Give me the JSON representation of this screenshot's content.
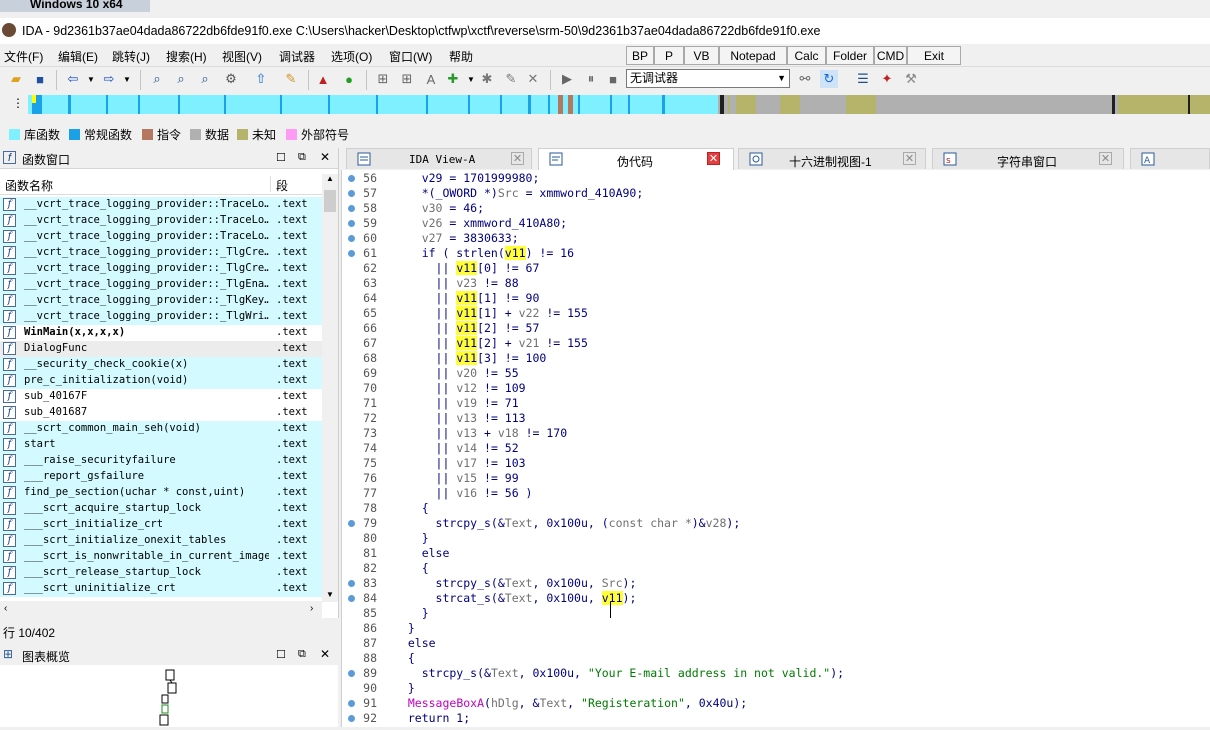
{
  "vm_tab": "Windows 10 x64",
  "window_title": "IDA - 9d2361b37ae04dada86722db6fde91f0.exe C:\\Users\\hacker\\Desktop\\ctfwp\\xctf\\reverse\\srm-50\\9d2361b37ae04dada86722db6fde91f0.exe",
  "menu": [
    "文件(F)",
    "编辑(E)",
    "跳转(J)",
    "搜索(H)",
    "视图(V)",
    "调试器",
    "选项(O)",
    "窗口(W)",
    "帮助"
  ],
  "plugin_buttons": [
    "BP",
    "P",
    "VB",
    "Notepad",
    "Calc",
    "Folder",
    "CMD",
    "Exit"
  ],
  "debugger_select": "无调试器",
  "legend": [
    {
      "label": "库函数",
      "color": "#7ff0ff"
    },
    {
      "label": "常规函数",
      "color": "#1aa1e8"
    },
    {
      "label": "指令",
      "color": "#b47860"
    },
    {
      "label": "数据",
      "color": "#b0b0b0"
    },
    {
      "label": "未知",
      "color": "#b5b46a"
    },
    {
      "label": "外部符号",
      "color": "#ff9bf5"
    }
  ],
  "functions_window": {
    "title": "函数窗口",
    "col_name": "函数名称",
    "col_seg": "段",
    "rows": [
      {
        "name": "__vcrt_trace_logging_provider::TraceLo…",
        "seg": ".text",
        "lib": true
      },
      {
        "name": "__vcrt_trace_logging_provider::TraceLo…",
        "seg": ".text",
        "lib": true
      },
      {
        "name": "__vcrt_trace_logging_provider::TraceLo…",
        "seg": ".text",
        "lib": true
      },
      {
        "name": "__vcrt_trace_logging_provider::_TlgCre…",
        "seg": ".text",
        "lib": true
      },
      {
        "name": "__vcrt_trace_logging_provider::_TlgCre…",
        "seg": ".text",
        "lib": true
      },
      {
        "name": "__vcrt_trace_logging_provider::_TlgEna…",
        "seg": ".text",
        "lib": true
      },
      {
        "name": "__vcrt_trace_logging_provider::_TlgKey…",
        "seg": ".text",
        "lib": true
      },
      {
        "name": "__vcrt_trace_logging_provider::_TlgWri…",
        "seg": ".text",
        "lib": true
      },
      {
        "name": "WinMain(x,x,x,x)",
        "seg": ".text",
        "lib": false,
        "bold": true
      },
      {
        "name": "DialogFunc",
        "seg": ".text",
        "lib": false,
        "selected": true
      },
      {
        "name": "__security_check_cookie(x)",
        "seg": ".text",
        "lib": true
      },
      {
        "name": "pre_c_initialization(void)",
        "seg": ".text",
        "lib": true
      },
      {
        "name": "sub_40167F",
        "seg": ".text",
        "lib": false
      },
      {
        "name": "sub_401687",
        "seg": ".text",
        "lib": false
      },
      {
        "name": "__scrt_common_main_seh(void)",
        "seg": ".text",
        "lib": true
      },
      {
        "name": "start",
        "seg": ".text",
        "lib": true
      },
      {
        "name": "___raise_securityfailure",
        "seg": ".text",
        "lib": true
      },
      {
        "name": "___report_gsfailure",
        "seg": ".text",
        "lib": true
      },
      {
        "name": "find_pe_section(uchar * const,uint)",
        "seg": ".text",
        "lib": true
      },
      {
        "name": "___scrt_acquire_startup_lock",
        "seg": ".text",
        "lib": true
      },
      {
        "name": "___scrt_initialize_crt",
        "seg": ".text",
        "lib": true
      },
      {
        "name": "___scrt_initialize_onexit_tables",
        "seg": ".text",
        "lib": true
      },
      {
        "name": "___scrt_is_nonwritable_in_current_image",
        "seg": ".text",
        "lib": true
      },
      {
        "name": "___scrt_release_startup_lock",
        "seg": ".text",
        "lib": true
      },
      {
        "name": "___scrt_uninitialize_crt",
        "seg": ".text",
        "lib": true
      }
    ]
  },
  "status_line": "行 10/402",
  "graph_overview_title": "图表概览",
  "tabs": [
    {
      "label": "IDA View-A",
      "active": false
    },
    {
      "label": "伪代码",
      "active": true
    },
    {
      "label": "十六进制视图-1",
      "active": false
    },
    {
      "label": "字符串窗口",
      "active": false
    }
  ],
  "code_lines": [
    {
      "n": "56",
      "dot": true,
      "segs": [
        [
          "    v29 = 1701999980;",
          ""
        ]
      ]
    },
    {
      "n": "57",
      "dot": true,
      "segs": [
        [
          "    *(_OWORD *)",
          ""
        ],
        [
          "Src",
          "gray"
        ],
        [
          " = xmmword_410A90;",
          ""
        ]
      ]
    },
    {
      "n": "58",
      "dot": true,
      "segs": [
        [
          "    ",
          ""
        ],
        [
          "v30",
          "gray"
        ],
        [
          " = 46;",
          ""
        ]
      ]
    },
    {
      "n": "59",
      "dot": true,
      "segs": [
        [
          "    ",
          ""
        ],
        [
          "v26",
          "gray"
        ],
        [
          " = xmmword_410A80;",
          ""
        ]
      ]
    },
    {
      "n": "60",
      "dot": true,
      "segs": [
        [
          "    ",
          ""
        ],
        [
          "v27",
          "gray"
        ],
        [
          " = 3830633;",
          ""
        ]
      ]
    },
    {
      "n": "61",
      "dot": true,
      "segs": [
        [
          "    if ( strlen(",
          ""
        ],
        [
          "v11",
          "hl"
        ],
        [
          ") != 16",
          ""
        ]
      ]
    },
    {
      "n": "62",
      "dot": false,
      "segs": [
        [
          "      || ",
          ""
        ],
        [
          "v11",
          "hl"
        ],
        [
          "[0] != 67",
          ""
        ]
      ]
    },
    {
      "n": "63",
      "dot": false,
      "segs": [
        [
          "      || ",
          ""
        ],
        [
          "v23",
          "gray"
        ],
        [
          " != 88",
          ""
        ]
      ]
    },
    {
      "n": "64",
      "dot": false,
      "segs": [
        [
          "      || ",
          ""
        ],
        [
          "v11",
          "hl"
        ],
        [
          "[1] != 90",
          ""
        ]
      ]
    },
    {
      "n": "65",
      "dot": false,
      "segs": [
        [
          "      || ",
          ""
        ],
        [
          "v11",
          "hl"
        ],
        [
          "[1] + ",
          ""
        ],
        [
          "v22",
          "gray"
        ],
        [
          " != 155",
          ""
        ]
      ]
    },
    {
      "n": "66",
      "dot": false,
      "segs": [
        [
          "      || ",
          ""
        ],
        [
          "v11",
          "hl"
        ],
        [
          "[2] != 57",
          ""
        ]
      ]
    },
    {
      "n": "67",
      "dot": false,
      "segs": [
        [
          "      || ",
          ""
        ],
        [
          "v11",
          "hl"
        ],
        [
          "[2] + ",
          ""
        ],
        [
          "v21",
          "gray"
        ],
        [
          " != 155",
          ""
        ]
      ]
    },
    {
      "n": "68",
      "dot": false,
      "segs": [
        [
          "      || ",
          ""
        ],
        [
          "v11",
          "hl"
        ],
        [
          "[3] != 100",
          ""
        ]
      ]
    },
    {
      "n": "69",
      "dot": false,
      "segs": [
        [
          "      || ",
          ""
        ],
        [
          "v20",
          "gray"
        ],
        [
          " != 55",
          ""
        ]
      ]
    },
    {
      "n": "70",
      "dot": false,
      "segs": [
        [
          "      || ",
          ""
        ],
        [
          "v12",
          "gray"
        ],
        [
          " != 109",
          ""
        ]
      ]
    },
    {
      "n": "71",
      "dot": false,
      "segs": [
        [
          "      || ",
          ""
        ],
        [
          "v19",
          "gray"
        ],
        [
          " != 71",
          ""
        ]
      ]
    },
    {
      "n": "72",
      "dot": false,
      "segs": [
        [
          "      || ",
          ""
        ],
        [
          "v13",
          "gray"
        ],
        [
          " != 113",
          ""
        ]
      ]
    },
    {
      "n": "73",
      "dot": false,
      "segs": [
        [
          "      || ",
          ""
        ],
        [
          "v13",
          "gray"
        ],
        [
          " + ",
          ""
        ],
        [
          "v18",
          "gray"
        ],
        [
          " != 170",
          ""
        ]
      ]
    },
    {
      "n": "74",
      "dot": false,
      "segs": [
        [
          "      || ",
          ""
        ],
        [
          "v14",
          "gray"
        ],
        [
          " != 52",
          ""
        ]
      ]
    },
    {
      "n": "75",
      "dot": false,
      "segs": [
        [
          "      || ",
          ""
        ],
        [
          "v17",
          "gray"
        ],
        [
          " != 103",
          ""
        ]
      ]
    },
    {
      "n": "76",
      "dot": false,
      "segs": [
        [
          "      || ",
          ""
        ],
        [
          "v15",
          "gray"
        ],
        [
          " != 99",
          ""
        ]
      ]
    },
    {
      "n": "77",
      "dot": false,
      "segs": [
        [
          "      || ",
          ""
        ],
        [
          "v16",
          "gray"
        ],
        [
          " != 56 )",
          ""
        ]
      ]
    },
    {
      "n": "78",
      "dot": false,
      "segs": [
        [
          "    {",
          ""
        ]
      ]
    },
    {
      "n": "79",
      "dot": true,
      "segs": [
        [
          "      strcpy_s(&",
          ""
        ],
        [
          "Text",
          "gray"
        ],
        [
          ", 0x100u, (",
          ""
        ],
        [
          "const char *",
          "gray"
        ],
        [
          ")&",
          ""
        ],
        [
          "v28",
          "gray"
        ],
        [
          ");",
          ""
        ]
      ]
    },
    {
      "n": "80",
      "dot": false,
      "segs": [
        [
          "    }",
          ""
        ]
      ]
    },
    {
      "n": "81",
      "dot": false,
      "segs": [
        [
          "    else",
          ""
        ]
      ]
    },
    {
      "n": "82",
      "dot": false,
      "segs": [
        [
          "    {",
          ""
        ]
      ]
    },
    {
      "n": "83",
      "dot": true,
      "segs": [
        [
          "      strcpy_s(&",
          ""
        ],
        [
          "Text",
          "gray"
        ],
        [
          ", 0x100u, ",
          ""
        ],
        [
          "Src",
          "gray"
        ],
        [
          ");",
          ""
        ]
      ]
    },
    {
      "n": "84",
      "dot": true,
      "segs": [
        [
          "      strcat_s(&",
          ""
        ],
        [
          "Text",
          "gray"
        ],
        [
          ", 0x100u, ",
          ""
        ],
        [
          "v11",
          "hl"
        ],
        [
          ");",
          ""
        ]
      ]
    },
    {
      "n": "85",
      "dot": false,
      "segs": [
        [
          "    }",
          ""
        ]
      ]
    },
    {
      "n": "86",
      "dot": false,
      "segs": [
        [
          "  }",
          ""
        ]
      ]
    },
    {
      "n": "87",
      "dot": false,
      "segs": [
        [
          "  else",
          ""
        ]
      ]
    },
    {
      "n": "88",
      "dot": false,
      "segs": [
        [
          "  {",
          ""
        ]
      ]
    },
    {
      "n": "89",
      "dot": true,
      "segs": [
        [
          "    strcpy_s(&",
          ""
        ],
        [
          "Text",
          "gray"
        ],
        [
          ", 0x100u, ",
          ""
        ],
        [
          "\"Your E-mail address in not valid.\"",
          "str"
        ],
        [
          ");",
          ""
        ]
      ]
    },
    {
      "n": "90",
      "dot": false,
      "segs": [
        [
          "  }",
          ""
        ]
      ]
    },
    {
      "n": "91",
      "dot": true,
      "segs": [
        [
          "  ",
          ""
        ],
        [
          "MessageBoxA",
          "magenta"
        ],
        [
          "(",
          ""
        ],
        [
          "hDlg",
          "gray"
        ],
        [
          ", &",
          ""
        ],
        [
          "Text",
          "gray"
        ],
        [
          ", ",
          ""
        ],
        [
          "\"Registeration\"",
          "str"
        ],
        [
          ", 0x40u);",
          ""
        ]
      ]
    },
    {
      "n": "92",
      "dot": true,
      "segs": [
        [
          "  return 1;",
          ""
        ]
      ]
    }
  ]
}
